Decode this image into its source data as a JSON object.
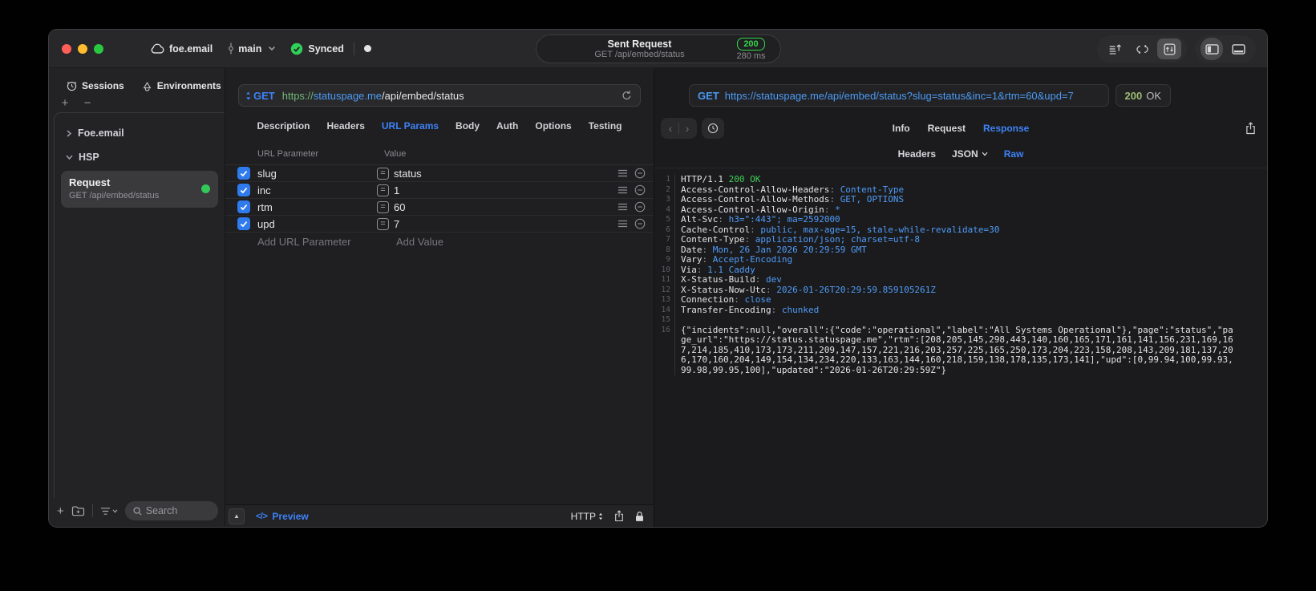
{
  "colors": {
    "accent_blue": "#3d82f7",
    "link_blue": "#4b9bf5",
    "success_green": "#32d74b",
    "url_scheme_green": "#71b877",
    "status_green": "#3fd158"
  },
  "titlebar": {
    "project": "foe.email",
    "branch": "main",
    "sync": "Synced",
    "request": {
      "title": "Sent Request",
      "subtitle": "GET /api/embed/status",
      "status": "200",
      "time": "280 ms"
    }
  },
  "sidebar": {
    "tabs": [
      {
        "label": "Sessions"
      },
      {
        "label": "Environments"
      }
    ],
    "tree": [
      {
        "label": "Foe.email"
      },
      {
        "label": "HSP"
      }
    ],
    "request_item": {
      "title": "Request",
      "subtitle": "GET /api/embed/status"
    },
    "search": {
      "placeholder": "Search"
    }
  },
  "request_panel": {
    "method": "GET",
    "url": {
      "scheme": "https://",
      "host": "statuspage.me",
      "path": "/api/embed/status"
    },
    "tabs": [
      "Description",
      "Headers",
      "URL Params",
      "Body",
      "Auth",
      "Options",
      "Testing"
    ],
    "active_tab": "URL Params",
    "params": {
      "columns": [
        "URL Parameter",
        "Value"
      ],
      "rows": [
        {
          "name": "slug",
          "value": "status",
          "enabled": true
        },
        {
          "name": "inc",
          "value": "1",
          "enabled": true
        },
        {
          "name": "rtm",
          "value": "60",
          "enabled": true
        },
        {
          "name": "upd",
          "value": "7",
          "enabled": true
        }
      ],
      "add_name": "Add URL Parameter",
      "add_value": "Add Value"
    },
    "footer": {
      "preview": "Preview",
      "http": "HTTP"
    }
  },
  "response_panel": {
    "method": "GET",
    "url": "https://statuspage.me/api/embed/status?slug=status&inc=1&rtm=60&upd=7",
    "status": "200",
    "status_text": "OK",
    "tabs": [
      "Info",
      "Request",
      "Response"
    ],
    "active_tab": "Response",
    "subtabs": [
      "Headers",
      "JSON",
      "Raw"
    ],
    "active_subtab": "Raw",
    "status_line": {
      "protocol": "HTTP/1.1",
      "status": "200 OK"
    },
    "headers": [
      {
        "name": "Access-Control-Allow-Headers",
        "value": "Content-Type"
      },
      {
        "name": "Access-Control-Allow-Methods",
        "value": "GET, OPTIONS"
      },
      {
        "name": "Access-Control-Allow-Origin",
        "value": "*"
      },
      {
        "name": "Alt-Svc",
        "value": "h3=\":443\"; ma=2592000"
      },
      {
        "name": "Cache-Control",
        "value": "public, max-age=15, stale-while-revalidate=30"
      },
      {
        "name": "Content-Type",
        "value": "application/json; charset=utf-8"
      },
      {
        "name": "Date",
        "value": "Mon, 26 Jan 2026 20:29:59 GMT"
      },
      {
        "name": "Vary",
        "value": "Accept-Encoding"
      },
      {
        "name": "Via",
        "value": "1.1 Caddy"
      },
      {
        "name": "X-Status-Build",
        "value": "dev"
      },
      {
        "name": "X-Status-Now-Utc",
        "value": "2026-01-26T20:29:59.859105261Z"
      },
      {
        "name": "Connection",
        "value": "close"
      },
      {
        "name": "Transfer-Encoding",
        "value": "chunked"
      }
    ],
    "body": "{\"incidents\":null,\"overall\":{\"code\":\"operational\",\"label\":\"All Systems Operational\"},\"page\":\"status\",\"page_url\":\"https://status.statuspage.me\",\"rtm\":[208,205,145,298,443,140,160,165,171,161,141,156,231,169,167,214,185,410,173,173,211,209,147,157,221,216,203,257,225,165,250,173,204,223,158,208,143,209,181,137,206,170,160,204,149,154,134,234,220,133,163,144,160,218,159,138,178,135,173,141],\"upd\":[0,99.94,100,99.93,99.98,99.95,100],\"updated\":\"2026-01-26T20:29:59Z\"}"
  }
}
